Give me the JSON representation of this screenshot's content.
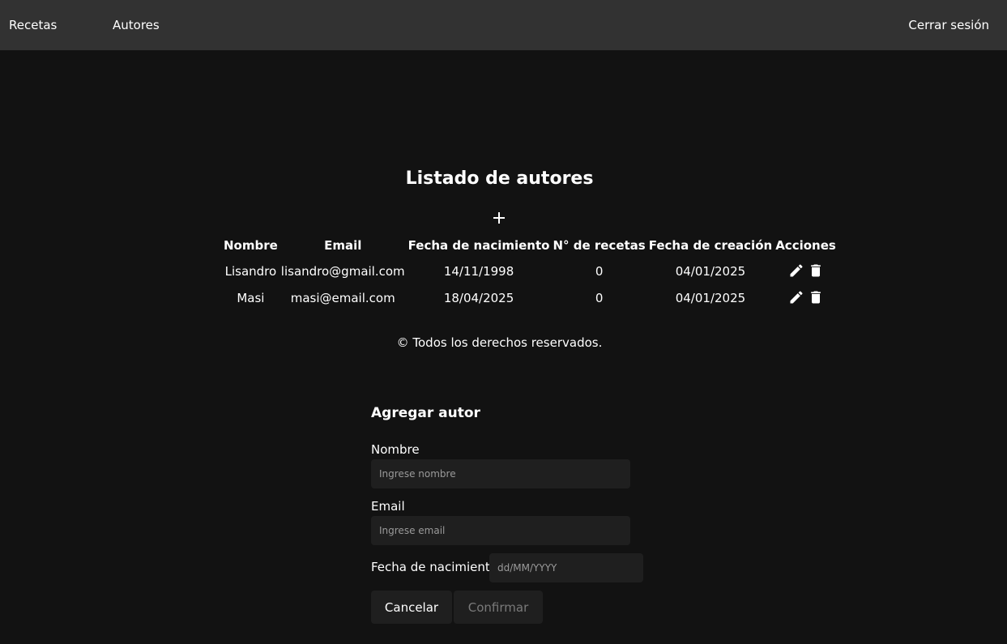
{
  "nav": {
    "recetas": "Recetas",
    "autores": "Autores",
    "logout": "Cerrar sesión"
  },
  "page": {
    "title": "Listado de autores"
  },
  "table": {
    "headers": {
      "nombre": "Nombre",
      "email": "Email",
      "fecha_nacimiento": "Fecha de nacimiento",
      "num_recetas": "N° de recetas",
      "fecha_creacion": "Fecha de creación",
      "acciones": "Acciones"
    },
    "rows": [
      {
        "nombre": "Lisandro",
        "email": "lisandro@gmail.com",
        "fecha_nacimiento": "14/11/1998",
        "num_recetas": "0",
        "fecha_creacion": "04/01/2025"
      },
      {
        "nombre": "Masi",
        "email": "masi@email.com",
        "fecha_nacimiento": "18/04/2025",
        "num_recetas": "0",
        "fecha_creacion": "04/01/2025"
      }
    ],
    "icons": {
      "add": "plus-icon",
      "edit": "pencil-icon",
      "delete": "trash-icon"
    }
  },
  "footer": {
    "copyright": "© Todos los derechos reservados."
  },
  "form": {
    "title": "Agregar autor",
    "nombre_label": "Nombre",
    "nombre_placeholder": "Ingrese nombre",
    "nombre_value": "",
    "email_label": "Email",
    "email_placeholder": "Ingrese email",
    "email_value": "",
    "fecha_label": "Fecha de nacimiento",
    "fecha_placeholder": "dd/MM/YYYY",
    "fecha_value": "",
    "cancel_label": "Cancelar",
    "confirm_label": "Confirmar"
  },
  "colors": {
    "background": "#121212",
    "navbar": "#323232",
    "input_background": "#1f1f1f",
    "disabled_text": "#7a7a7a"
  }
}
